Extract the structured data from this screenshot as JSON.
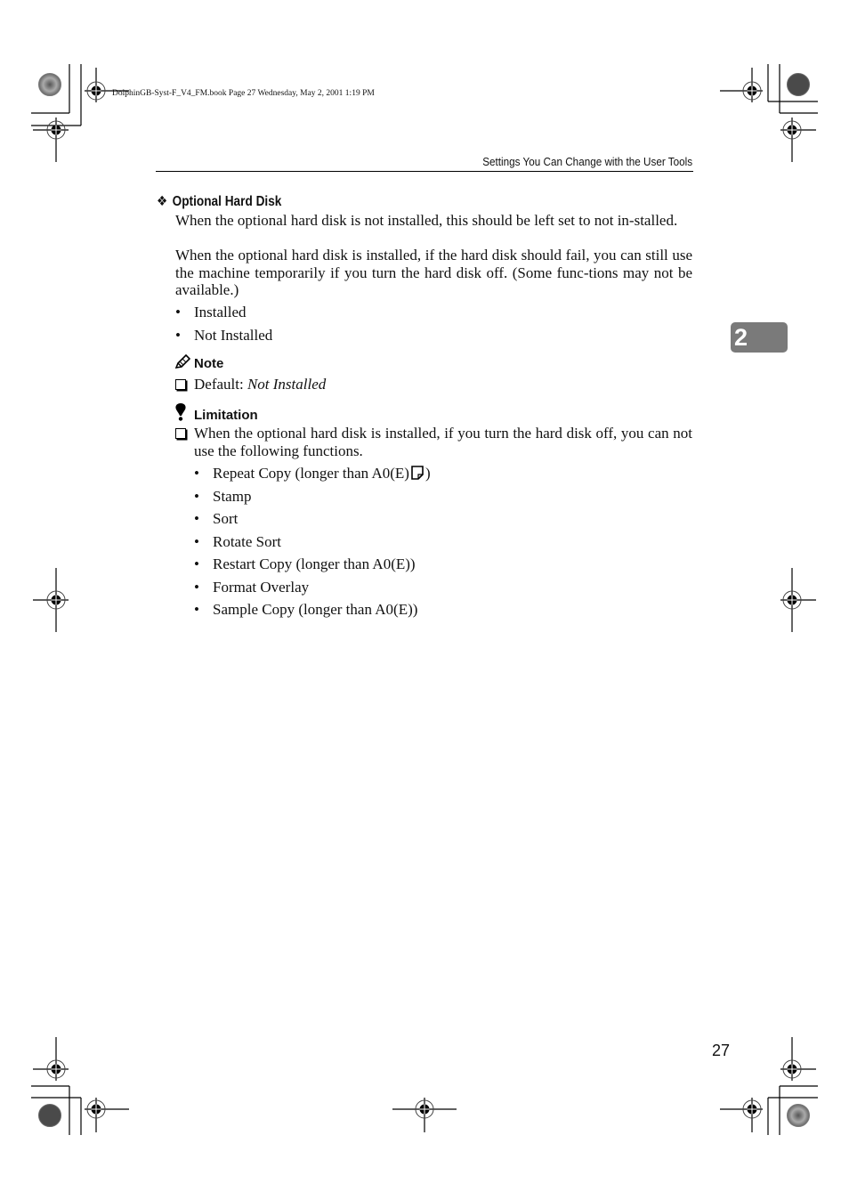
{
  "slug_line": "DolphinGB-Syst-F_V4_FM.book  Page 27  Wednesday, May 2, 2001  1:19 PM",
  "running_head": "Settings You Can Change with the User Tools",
  "chapter_tab": "2",
  "page_number": "27",
  "section": {
    "bullet_icon": "diamond-bullet-icon",
    "bullet_glyph": "❖",
    "title": "Optional Hard Disk",
    "paragraphs": [
      "When the optional hard disk is not installed, this should be left set to not in-stalled.",
      "When the optional hard disk is installed, if the hard disk should fail, you can still use the machine temporarily if you turn the hard disk off. (Some func-tions may not be available.)"
    ],
    "options": [
      "Installed",
      "Not Installed"
    ]
  },
  "note": {
    "icon": "pencil-icon",
    "title": "Note",
    "items": [
      {
        "label": "Default: ",
        "value": "Not Installed"
      }
    ]
  },
  "limitation": {
    "icon": "exclamation-icon",
    "title": "Limitation",
    "items": [
      {
        "text": "When the optional hard disk is installed, if you turn the hard disk off, you can not use the following functions."
      }
    ],
    "functions": [
      {
        "text": "Repeat Copy (longer than A0(E)",
        "icon": "paper-orientation-icon",
        "suffix": ")"
      },
      {
        "text": "Stamp"
      },
      {
        "text": "Sort"
      },
      {
        "text": "Rotate Sort"
      },
      {
        "text": "Restart Copy (longer than A0(E))"
      },
      {
        "text": "Format Overlay"
      },
      {
        "text": "Sample Copy (longer than A0(E))"
      }
    ]
  }
}
